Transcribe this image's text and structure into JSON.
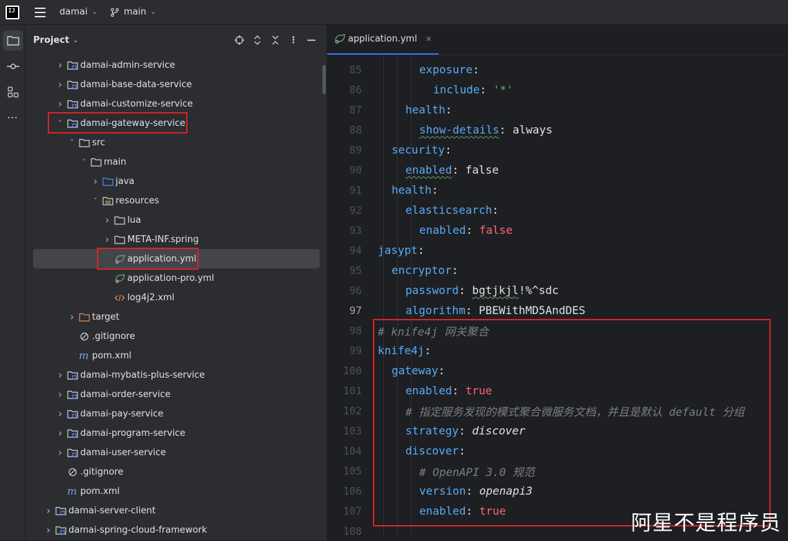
{
  "titlebar": {
    "logo_text": "IJ",
    "project_name": "damai",
    "branch_name": "main"
  },
  "project_panel": {
    "title": "Project"
  },
  "tree": [
    {
      "label": "damai-admin-service",
      "depth": 1,
      "kind": "module",
      "chevron": "right"
    },
    {
      "label": "damai-base-data-service",
      "depth": 1,
      "kind": "module",
      "chevron": "right"
    },
    {
      "label": "damai-customize-service",
      "depth": 1,
      "kind": "module",
      "chevron": "right"
    },
    {
      "label": "damai-gateway-service",
      "depth": 1,
      "kind": "module",
      "chevron": "down"
    },
    {
      "label": "src",
      "depth": 2,
      "kind": "folder",
      "chevron": "down"
    },
    {
      "label": "main",
      "depth": 3,
      "kind": "folder",
      "chevron": "down"
    },
    {
      "label": "java",
      "depth": 4,
      "kind": "source-folder",
      "chevron": "right"
    },
    {
      "label": "resources",
      "depth": 4,
      "kind": "resource-folder",
      "chevron": "down"
    },
    {
      "label": "lua",
      "depth": 5,
      "kind": "folder",
      "chevron": "right"
    },
    {
      "label": "META-INF.spring",
      "depth": 5,
      "kind": "folder",
      "chevron": "right"
    },
    {
      "label": "application.yml",
      "depth": 5,
      "kind": "yml",
      "chevron": "none",
      "selected": true
    },
    {
      "label": "application-pro.yml",
      "depth": 5,
      "kind": "yml",
      "chevron": "none"
    },
    {
      "label": "log4j2.xml",
      "depth": 5,
      "kind": "xml",
      "chevron": "none"
    },
    {
      "label": "target",
      "depth": 2,
      "kind": "excluded-folder",
      "chevron": "right"
    },
    {
      "label": ".gitignore",
      "depth": 2,
      "kind": "ignore",
      "chevron": "none"
    },
    {
      "label": "pom.xml",
      "depth": 2,
      "kind": "maven",
      "chevron": "none"
    },
    {
      "label": "damai-mybatis-plus-service",
      "depth": 1,
      "kind": "module",
      "chevron": "right"
    },
    {
      "label": "damai-order-service",
      "depth": 1,
      "kind": "module",
      "chevron": "right"
    },
    {
      "label": "damai-pay-service",
      "depth": 1,
      "kind": "module",
      "chevron": "right"
    },
    {
      "label": "damai-program-service",
      "depth": 1,
      "kind": "module",
      "chevron": "right"
    },
    {
      "label": "damai-user-service",
      "depth": 1,
      "kind": "module",
      "chevron": "right"
    },
    {
      "label": ".gitignore",
      "depth": 1,
      "kind": "ignore",
      "chevron": "none"
    },
    {
      "label": "pom.xml",
      "depth": 1,
      "kind": "maven",
      "chevron": "none"
    },
    {
      "label": "damai-server-client",
      "depth": 0,
      "kind": "module",
      "chevron": "right"
    },
    {
      "label": "damai-spring-cloud-framework",
      "depth": 0,
      "kind": "module",
      "chevron": "right"
    }
  ],
  "editor": {
    "tab_label": "application.yml",
    "current_line": 97,
    "lines": [
      {
        "n": "85",
        "indent": 3,
        "parts": [
          [
            "key",
            "exposure"
          ],
          [
            "val",
            ":"
          ]
        ]
      },
      {
        "n": "86",
        "indent": 4,
        "parts": [
          [
            "key",
            "include"
          ],
          [
            "val",
            ": "
          ],
          [
            "str",
            "'*'"
          ]
        ]
      },
      {
        "n": "87",
        "indent": 2,
        "parts": [
          [
            "key",
            "health"
          ],
          [
            "val",
            ":"
          ]
        ]
      },
      {
        "n": "88",
        "indent": 3,
        "parts": [
          [
            "key squiggle",
            "show-details"
          ],
          [
            "val",
            ": always"
          ]
        ]
      },
      {
        "n": "89",
        "indent": 1,
        "parts": [
          [
            "key",
            "security"
          ],
          [
            "val",
            ":"
          ]
        ]
      },
      {
        "n": "90",
        "indent": 2,
        "parts": [
          [
            "key squiggle",
            "enabled"
          ],
          [
            "val",
            ": false"
          ]
        ]
      },
      {
        "n": "91",
        "indent": 1,
        "parts": [
          [
            "key",
            "health"
          ],
          [
            "val",
            ":"
          ]
        ]
      },
      {
        "n": "92",
        "indent": 2,
        "parts": [
          [
            "key",
            "elasticsearch"
          ],
          [
            "val",
            ":"
          ]
        ]
      },
      {
        "n": "93",
        "indent": 3,
        "parts": [
          [
            "key",
            "enabled"
          ],
          [
            "val",
            ": "
          ],
          [
            "bool",
            "false"
          ]
        ]
      },
      {
        "n": "94",
        "indent": 0,
        "parts": [
          [
            "key",
            "jasypt"
          ],
          [
            "val",
            ":"
          ]
        ]
      },
      {
        "n": "95",
        "indent": 1,
        "parts": [
          [
            "key",
            "encryptor"
          ],
          [
            "val",
            ":"
          ]
        ]
      },
      {
        "n": "96",
        "indent": 2,
        "parts": [
          [
            "key",
            "password"
          ],
          [
            "val",
            ": "
          ],
          [
            "val squiggle",
            "bgtjkjl"
          ],
          [
            "val",
            "!%^sdc"
          ]
        ]
      },
      {
        "n": "97",
        "indent": 2,
        "parts": [
          [
            "key",
            "algorithm"
          ],
          [
            "val",
            ": PBEWithMD5AndDES"
          ]
        ]
      },
      {
        "n": "98",
        "indent": 0,
        "parts": [
          [
            "comment",
            "# knife4j 网关聚合"
          ]
        ]
      },
      {
        "n": "99",
        "indent": 0,
        "parts": [
          [
            "key",
            "knife4j"
          ],
          [
            "val",
            ":"
          ]
        ]
      },
      {
        "n": "100",
        "indent": 1,
        "parts": [
          [
            "key",
            "gateway"
          ],
          [
            "val",
            ":"
          ]
        ]
      },
      {
        "n": "101",
        "indent": 2,
        "parts": [
          [
            "key",
            "enabled"
          ],
          [
            "val",
            ": "
          ],
          [
            "bool",
            "true"
          ]
        ]
      },
      {
        "n": "102",
        "indent": 2,
        "parts": [
          [
            "comment",
            "# 指定服务发现的模式聚合微服务文档，并且是默认 default 分组"
          ]
        ]
      },
      {
        "n": "103",
        "indent": 2,
        "parts": [
          [
            "key",
            "strategy"
          ],
          [
            "val",
            ": "
          ],
          [
            "ital",
            "discover"
          ]
        ]
      },
      {
        "n": "104",
        "indent": 2,
        "parts": [
          [
            "key",
            "discover"
          ],
          [
            "val",
            ":"
          ]
        ]
      },
      {
        "n": "105",
        "indent": 3,
        "parts": [
          [
            "comment",
            "# OpenAPI 3.0 规范"
          ]
        ]
      },
      {
        "n": "106",
        "indent": 3,
        "parts": [
          [
            "key",
            "version"
          ],
          [
            "val",
            ": "
          ],
          [
            "ital",
            "openapi3"
          ]
        ]
      },
      {
        "n": "107",
        "indent": 3,
        "parts": [
          [
            "key",
            "enabled"
          ],
          [
            "val",
            ": "
          ],
          [
            "bool",
            "true"
          ]
        ]
      },
      {
        "n": "108",
        "indent": 0,
        "parts": []
      }
    ]
  },
  "watermark": "阿星不是程序员",
  "colors": {
    "highlight_box": "#d42528",
    "accent": "#3574f0",
    "yaml_key": "#57aaf7",
    "yaml_bool": "#fa6675"
  }
}
